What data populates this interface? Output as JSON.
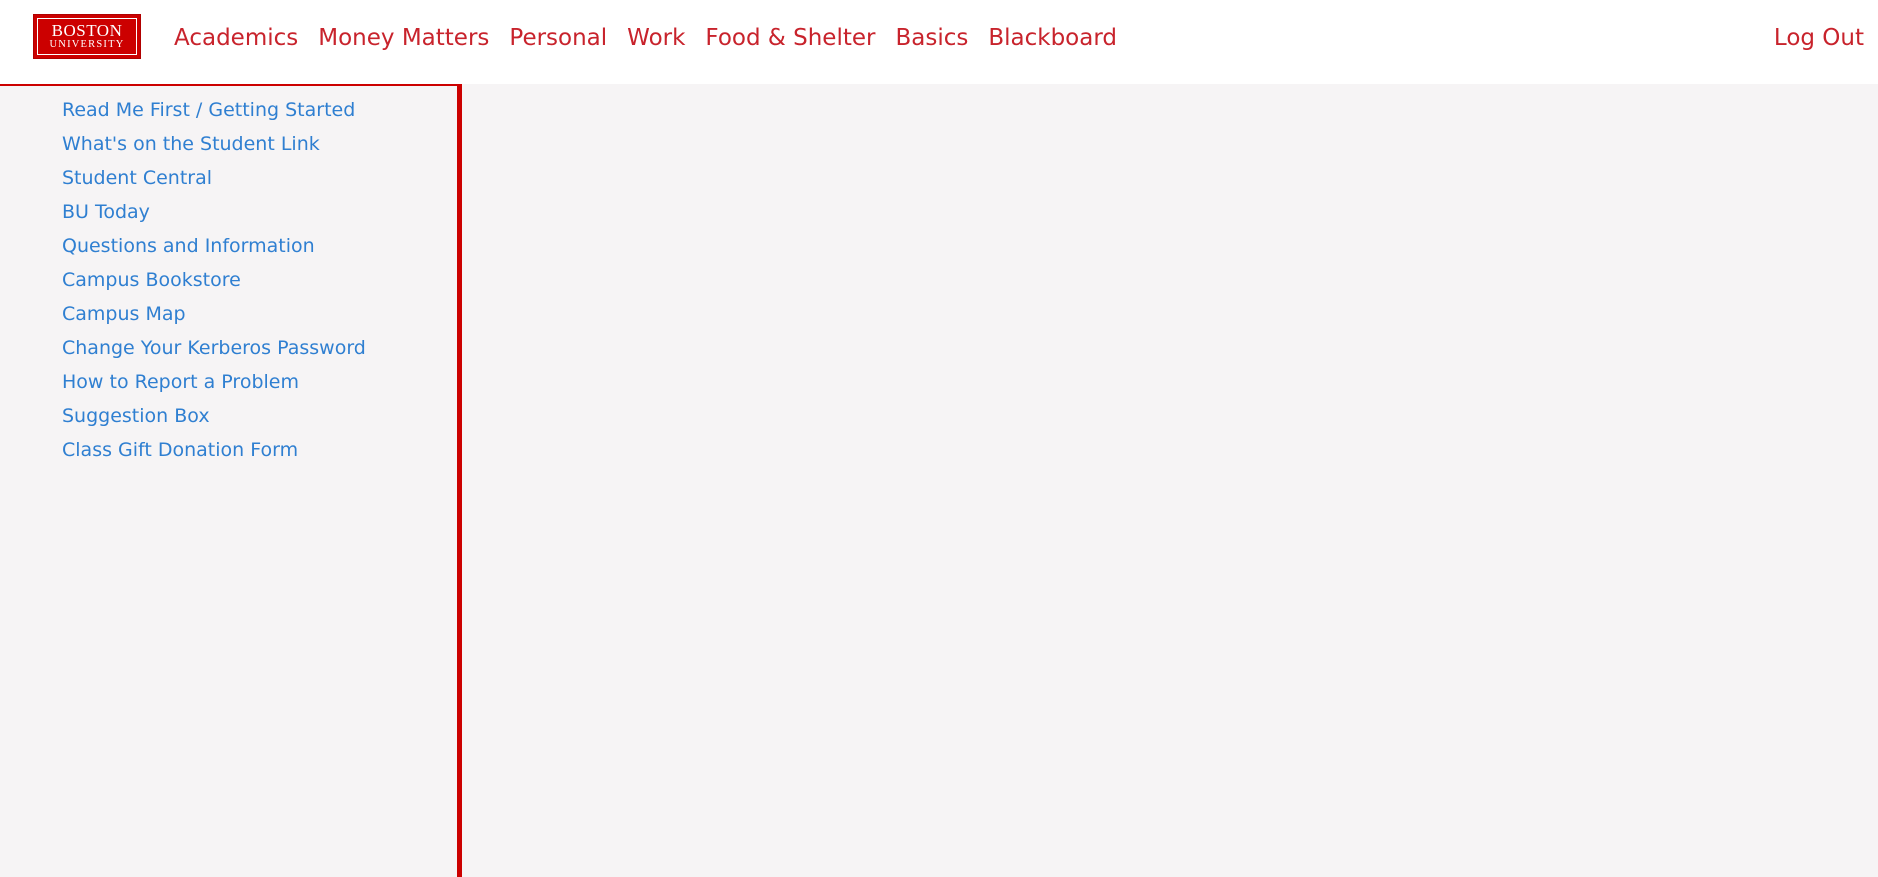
{
  "header": {
    "logo": {
      "line1": "BOSTON",
      "line2": "UNIVERSITY"
    },
    "nav": [
      {
        "label": "Academics"
      },
      {
        "label": "Money Matters"
      },
      {
        "label": "Personal"
      },
      {
        "label": "Work"
      },
      {
        "label": "Food & Shelter"
      },
      {
        "label": "Basics"
      },
      {
        "label": "Blackboard"
      }
    ],
    "logout_label": "Log Out"
  },
  "sidebar": {
    "links": [
      {
        "label": "Read Me First / Getting Started"
      },
      {
        "label": "What's on the Student Link"
      },
      {
        "label": "Student Central"
      },
      {
        "label": "BU Today"
      },
      {
        "label": "Questions and Information"
      },
      {
        "label": "Campus Bookstore"
      },
      {
        "label": "Campus Map"
      },
      {
        "label": "Change Your Kerberos Password"
      },
      {
        "label": "How to Report a Problem"
      },
      {
        "label": "Suggestion Box"
      },
      {
        "label": "Class Gift Donation Form"
      }
    ]
  },
  "colors": {
    "brand_red": "#cc0000",
    "nav_text": "#c8232c",
    "link_blue": "#2f7fd1",
    "background": "#f6f4f5"
  }
}
